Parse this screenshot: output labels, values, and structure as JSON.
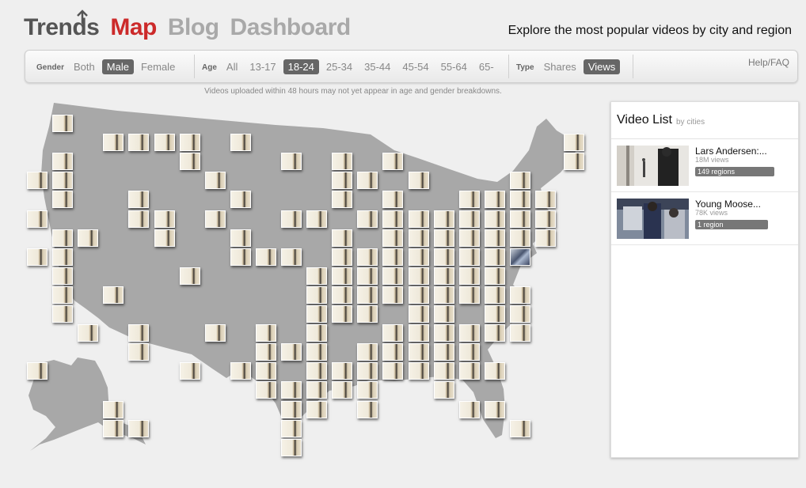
{
  "header": {
    "nav": [
      "Trends",
      "Map",
      "Blog",
      "Dashboard"
    ],
    "tagline": "Explore the most popular videos by city and region"
  },
  "filters": {
    "gender": {
      "label": "Gender",
      "options": [
        "Both",
        "Male",
        "Female"
      ],
      "selected": "Male"
    },
    "age": {
      "label": "Age",
      "options": [
        "All",
        "13-17",
        "18-24",
        "25-34",
        "35-44",
        "45-54",
        "55-64",
        "65-"
      ],
      "selected": "18-24"
    },
    "type": {
      "label": "Type",
      "options": [
        "Shares",
        "Views"
      ],
      "selected": "Views"
    },
    "help": "Help/FAQ"
  },
  "note": "Videos uploaded within 48 hours may not yet appear in age and gender breakdowns.",
  "video_list": {
    "title": "Video List",
    "subtitle": "by cities",
    "items": [
      {
        "title": "Lars Andersen:...",
        "views": "18M views",
        "badge": "149 regions",
        "badge_fraction": 1.0
      },
      {
        "title": "Young Moose...",
        "views": "78K views",
        "badge": "1 region",
        "badge_fraction": 0.92
      }
    ]
  },
  "colors": {
    "accent_red": "#cc2a2a",
    "selected_bg": "#666666",
    "map_fill": "#a8a8a8"
  }
}
